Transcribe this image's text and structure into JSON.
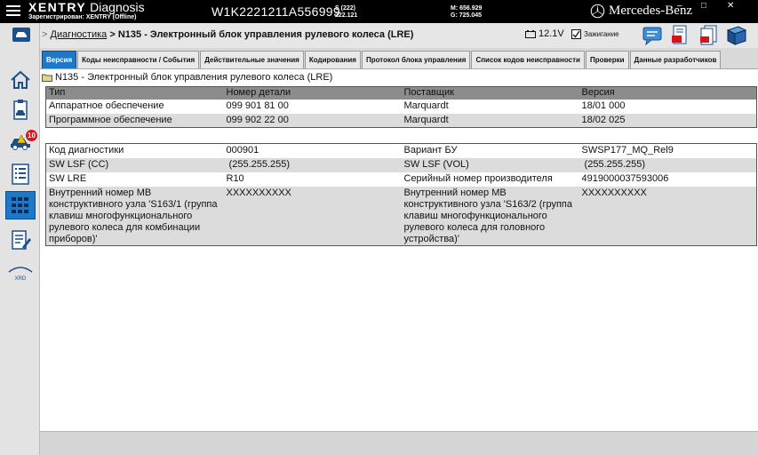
{
  "header": {
    "app_name_bold": "XENTRY",
    "app_name": "Diagnosis",
    "registered": "Зарегистрирован: XENTRY (Offline)",
    "vin": "W1K2221211A556999",
    "s_line1": "S (222)",
    "s_line2": "222.121",
    "m_line": "M: 656.929",
    "g_line": "G: 725.045",
    "brand": "Mercedes-Benz",
    "minimize": "–",
    "maximize": "□",
    "close": "✕"
  },
  "sidebar": {
    "items": [
      {
        "name": "home-icon"
      },
      {
        "name": "vehicle-clipboard-icon"
      },
      {
        "name": "car-fault-icon",
        "badge": "10"
      },
      {
        "name": "list-icon"
      },
      {
        "name": "control-units-icon"
      },
      {
        "name": "edit-document-icon"
      },
      {
        "name": "xrd-icon",
        "label": "XRD"
      }
    ]
  },
  "breadcrumb": {
    "prefix": ">",
    "link": "Диагностика",
    "separator": ">",
    "current": "N135 - Электронный блок управления рулевого колеса (LRE)"
  },
  "status": {
    "voltage": "12.1V",
    "ignition": "Зажигание"
  },
  "tabs": [
    "Версия",
    "Коды неисправности / События",
    "Действительные значения",
    "Кодирования",
    "Протокол блока управления",
    "Список кодов неисправности",
    "Проверки",
    "Данные разработчиков"
  ],
  "node_title": "N135 - Электронный блок управления рулевого колеса (LRE)",
  "version_table": {
    "headers": [
      "Тип",
      "Номер детали",
      "Поставщик",
      "Версия"
    ],
    "rows": [
      [
        "Аппаратное обеспечение",
        "099 901 81 00",
        "Marquardt",
        "18/01 000"
      ],
      [
        "Программное обеспечение",
        "099 902 22 00",
        "Marquardt",
        "18/02 025"
      ]
    ]
  },
  "info_table": {
    "rows": [
      [
        "Код диагностики",
        "000901",
        "Вариант БУ",
        "SWSP177_MQ_Rel9"
      ],
      [
        "SW LSF (CC)",
        " (255.255.255)",
        "SW LSF (VOL)",
        " (255.255.255)"
      ],
      [
        "SW LRE",
        "R10",
        "Серийный номер производителя",
        "4919000037593006"
      ],
      [
        "Внутренний номер MB конструктивного узла 'S163/1 (группа клавиш многофункционального рулевого колеса для комбинации приборов)'",
        "XXXXXXXXXX",
        "Внутренний номер MB конструктивного узла 'S163/2 (группа клавиш многофункционального рулевого колеса для головного устройства)'",
        "XXXXXXXXXX"
      ]
    ]
  },
  "colors": {
    "active_tab": "#1e78c8",
    "header_bg": "#000000",
    "table_header": "#8c8c8c",
    "alt_row": "#dcdcdc",
    "badge": "#d8141b"
  }
}
